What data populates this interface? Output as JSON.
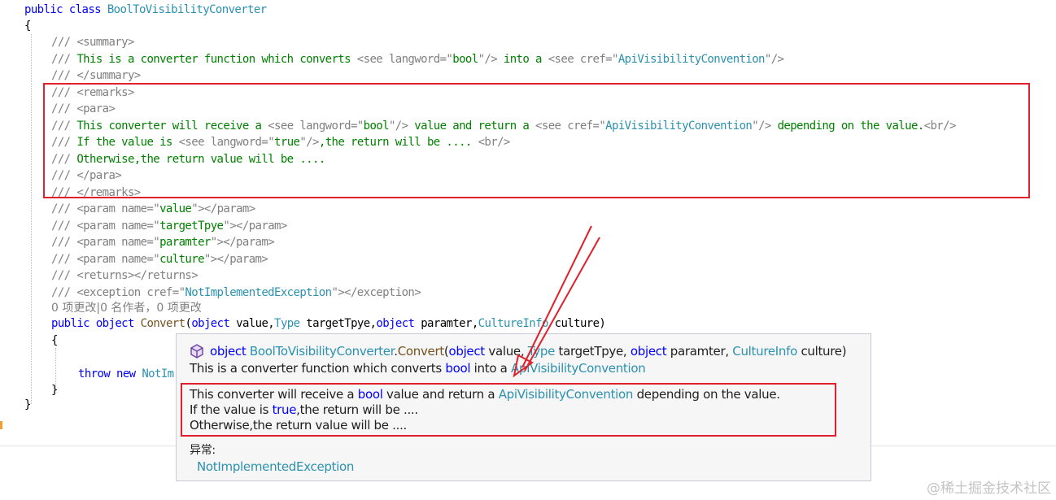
{
  "code": {
    "class_decl": {
      "modifier": "public",
      "keyword": "class",
      "name": "BoolToVisibilityConverter"
    },
    "open_brace": "{",
    "summary_open": "/// <summary>",
    "summary_text": "/// This is a converter function which converts <see langword=\"bool\"/> into a <see cref=\"ApiVisibilityConvention\"/>",
    "summary_close": "/// </summary>",
    "remarks_open": "/// <remarks>",
    "para_open": "/// <para>",
    "remarks_line1": "/// This converter will receive a <see langword=\"bool\"/> value and return a <see cref=\"ApiVisibilityConvention\"/> depending on the value.<br/>",
    "remarks_line2": "/// If the value is <see langword=\"true\"/>,the return will be .... <br/>",
    "remarks_line3": "/// Otherwise,the return value will be ....",
    "para_close": "/// </para>",
    "remarks_close": "/// </remarks>",
    "param_value": "/// <param name=\"value\"></param>",
    "param_targetTpye": "/// <param name=\"targetTpye\"></param>",
    "param_paramter": "/// <param name=\"paramter\"></param>",
    "param_culture": "/// <param name=\"culture\"></param>",
    "returns": "/// <returns></returns>",
    "exception": "/// <exception cref=\"NotImplementedException\"></exception>",
    "codelens": "0 项更改|0 名作者，0 项更改",
    "method_sig": {
      "public": "public",
      "object": "object",
      "name": "Convert",
      "open_paren": "(",
      "p1_type": "object",
      "p1_name": " value,",
      "p2_type": "Type",
      "p2_name": " targetTpye,",
      "p3_type": "object",
      "p3_name": " paramter,",
      "p4_type": "CultureInfo",
      "p4_name": " culture)"
    },
    "method_open_brace": "{",
    "throw_line": {
      "throw": "throw",
      "new": "new",
      "rest": "NotIm"
    },
    "method_close_brace": "}",
    "class_close_brace": "}"
  },
  "quickinfo": {
    "icon": "method-cube-icon",
    "sig_object": "object",
    "sig_class": "BoolToVisibilityConverter",
    "sig_dot": ".",
    "sig_method": "Convert",
    "sig_open": "(",
    "sig_p1_type": "object",
    "sig_p1_name": " value, ",
    "sig_p2_type": "Type",
    "sig_p2_name": " targetTpye, ",
    "sig_p3_type": "object",
    "sig_p3_name": " paramter, ",
    "sig_p4_type": "CultureInfo",
    "sig_p4_name": " culture)",
    "summary_prefix": "This is a converter function which converts ",
    "summary_bool": "bool",
    "summary_mid": " into a ",
    "summary_link": "ApiVisibilityConvention",
    "remarks1_prefix": "This converter will receive a ",
    "remarks1_bool": "bool",
    "remarks1_mid": " value and return a ",
    "remarks1_link": "ApiVisibilityConvention",
    "remarks1_suffix": " depending on the value.",
    "remarks2_prefix": "If the value is ",
    "remarks2_true": "true",
    "remarks2_suffix": ",the return will be ....",
    "remarks3": "Otherwise,the return value will be ....",
    "exceptions_heading": "异常:",
    "exception_name": "NotImplementedException"
  },
  "watermark": "@稀土掘金技术社区",
  "colors": {
    "keyword": "#0000ff",
    "comment": "#008000",
    "xml_tag": "#808080",
    "type": "#2b91af",
    "highlight": "#e0202a",
    "method": "#74531f"
  }
}
